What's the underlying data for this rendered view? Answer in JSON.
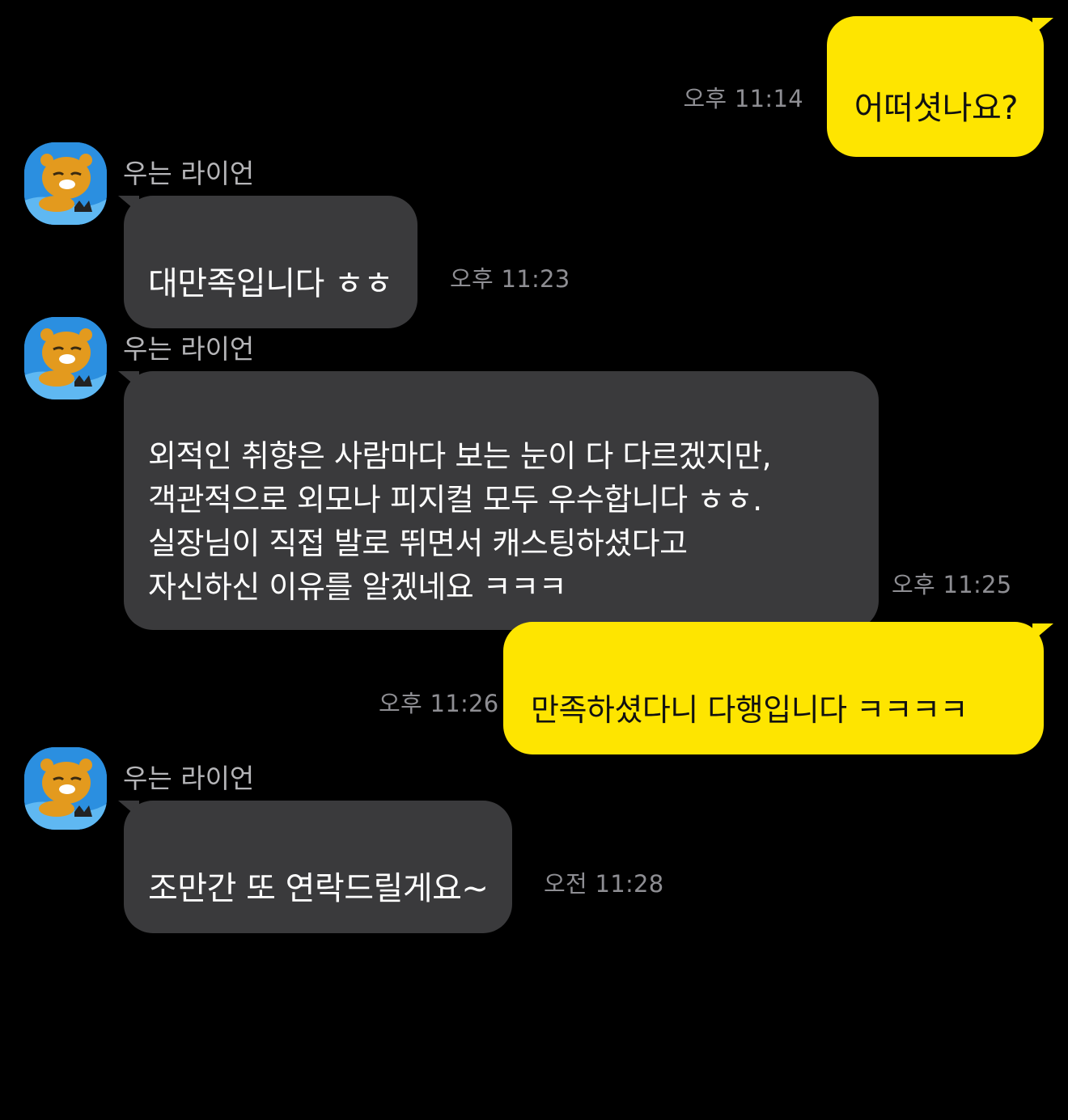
{
  "messages": [
    {
      "direction": "sent",
      "text": "어떠셧나요?",
      "time": "오후 11:14"
    },
    {
      "direction": "received",
      "sender": "우는 라이언",
      "avatar_icon": "ryan-avatar-icon",
      "text": "대만족입니다 ㅎㅎ",
      "time": "오후 11:23"
    },
    {
      "direction": "received",
      "sender": "우는 라이언",
      "avatar_icon": "ryan-avatar-icon",
      "text": "외적인 취향은 사람마다 보는 눈이 다 다르겠지만,\n객관적으로 외모나 피지컬 모두 우수합니다 ㅎㅎ.\n실장님이 직접 발로 뛰면서 캐스팅하셨다고\n자신하신 이유를 알겠네요 ㅋㅋㅋ",
      "time": "오후 11:25"
    },
    {
      "direction": "sent",
      "text": "만족하셨다니 다행입니다 ㅋㅋㅋㅋ",
      "time": "오후 11:26"
    },
    {
      "direction": "received",
      "sender": "우는 라이언",
      "avatar_icon": "ryan-avatar-icon",
      "text": "조만간 또 연락드릴게요~",
      "time": "오전 11:28"
    }
  ],
  "colors": {
    "background": "#000000",
    "sent_bubble": "#FEE500",
    "received_bubble": "#3A3A3C",
    "timestamp": "#8E8E93",
    "sender_name": "#B5B5B8",
    "avatar_bg": "#2B8FE0"
  }
}
